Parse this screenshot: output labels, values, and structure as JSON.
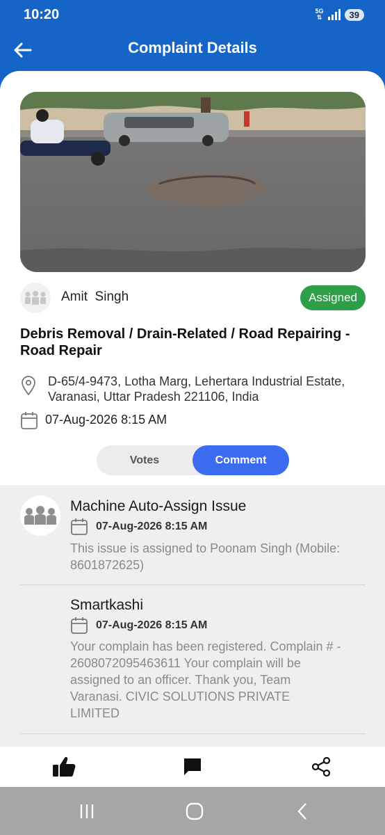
{
  "status_bar": {
    "time": "10:20",
    "network": "5G",
    "battery": "39"
  },
  "header": {
    "title": "Complaint Details",
    "back_icon": "arrow-left-icon"
  },
  "complaint": {
    "reporter_name": "Amit  Singh",
    "status": "Assigned",
    "title": "Debris Removal / Drain-Related / Road Repairing - Road Repair",
    "address": "D-65/4-9473, Lotha Marg, Lehertara Industrial Estate, Varanasi, Uttar Pradesh 221106, India",
    "datetime": "07-Aug-2026 8:15 AM"
  },
  "tabs": {
    "votes": "Votes",
    "comment": "Comment",
    "active": "comment"
  },
  "comments": [
    {
      "author": "Machine Auto-Assign Issue",
      "date": "07-Aug-2026 8:15 AM",
      "text": "This issue is assigned to Poonam Singh (Mobile: 8601872625)"
    },
    {
      "author": "Smartkashi",
      "date": "07-Aug-2026 8:15 AM",
      "text": "Your complain has been registered. Complain # - 2608072095463611 Your complain will be assigned to an officer. Thank you, Team Varanasi. CIVIC SOLUTIONS PRIVATE LIMITED"
    }
  ],
  "colors": {
    "header": "#1565c8",
    "badge": "#2e9e48",
    "toggle_active": "#3b6cf0",
    "comments_bg": "#efefef"
  },
  "actions": [
    "thumbs-up-icon",
    "comment-icon",
    "share-icon"
  ]
}
